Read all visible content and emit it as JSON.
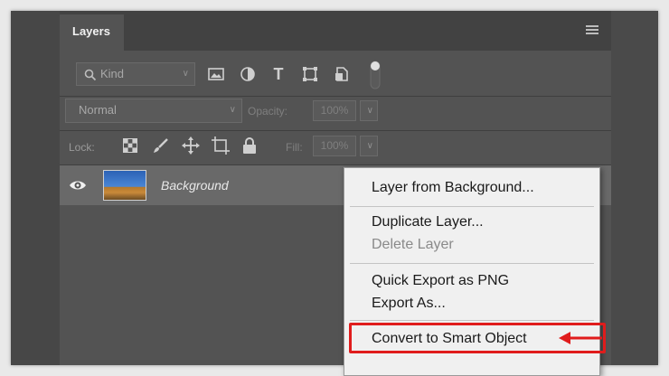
{
  "panel": {
    "tab_label": "Layers",
    "menu_icon": "hamburger-icon"
  },
  "filter": {
    "kind_label": "Kind",
    "icons": [
      "pixel-layer-filter-icon",
      "adjustment-layer-filter-icon",
      "type-layer-filter-icon",
      "shape-layer-filter-icon",
      "smart-object-filter-icon",
      "filter-toggle-icon"
    ]
  },
  "blend": {
    "mode": "Normal",
    "opacity_label": "Opacity:",
    "opacity_value": "100%"
  },
  "lock": {
    "label": "Lock:",
    "icons": [
      "lock-transparent-pixels-icon",
      "lock-image-pixels-icon",
      "lock-position-icon",
      "lock-artboard-icon",
      "lock-all-icon"
    ],
    "fill_label": "Fill:",
    "fill_value": "100%"
  },
  "layers": [
    {
      "name": "Background",
      "visible": true
    }
  ],
  "context_menu": {
    "items": [
      {
        "label": "Layer from Background...",
        "enabled": true
      },
      {
        "label": "Duplicate Layer...",
        "enabled": true
      },
      {
        "label": "Delete Layer",
        "enabled": false
      },
      {
        "label": "Quick Export as PNG",
        "enabled": true
      },
      {
        "label": "Export As...",
        "enabled": true
      },
      {
        "label": "Convert to Smart Object",
        "enabled": true
      }
    ]
  },
  "annotation": {
    "color": "#e01c1c",
    "highlighted_item": "Convert to Smart Object"
  }
}
